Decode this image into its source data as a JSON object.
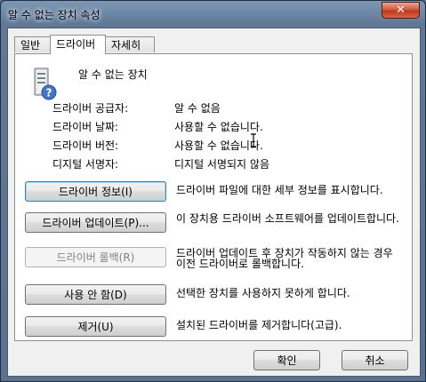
{
  "window": {
    "title": "알 수 없는 장치 속성",
    "close_glyph": "✕"
  },
  "tabs": [
    {
      "label": "일반",
      "active": false
    },
    {
      "label": "드라이버",
      "active": true
    },
    {
      "label": "자세히",
      "active": false
    }
  ],
  "device": {
    "name": "알 수 없는 장치",
    "icon": "unknown-device-icon"
  },
  "properties": [
    {
      "label": "드라이버 공급자:",
      "value": "알 수 없음"
    },
    {
      "label": "드라이버 날짜:",
      "value": "사용할 수 없습니다."
    },
    {
      "label": "드라이버 버전:",
      "value": "사용할 수 없습니다."
    },
    {
      "label": "디지털 서명자:",
      "value": "디지털 서명되지 않음"
    }
  ],
  "actions": [
    {
      "label": "드라이버 정보(I)",
      "desc": "드라이버 파일에 대한 세부 정보를 표시합니다.",
      "enabled": true,
      "focused": true
    },
    {
      "label": "드라이버 업데이트(P)...",
      "desc": "이 장치용 드라이버 소프트웨어를 업데이트합니다.",
      "enabled": true,
      "focused": false
    },
    {
      "label": "드라이버 롤백(R)",
      "desc": "드라이버 업데이트 후 장치가 작동하지 않는 경우 이전 드라이버로 롤백합니다.",
      "enabled": false,
      "focused": false
    },
    {
      "label": "사용 안 함(D)",
      "desc": "선택한 장치를 사용하지 못하게 합니다.",
      "enabled": true,
      "focused": false
    },
    {
      "label": "제거(U)",
      "desc": "설치된 드라이버를 제거합니다(고급).",
      "enabled": true,
      "focused": false
    }
  ],
  "footer": {
    "ok_label": "확인",
    "cancel_label": "취소"
  }
}
